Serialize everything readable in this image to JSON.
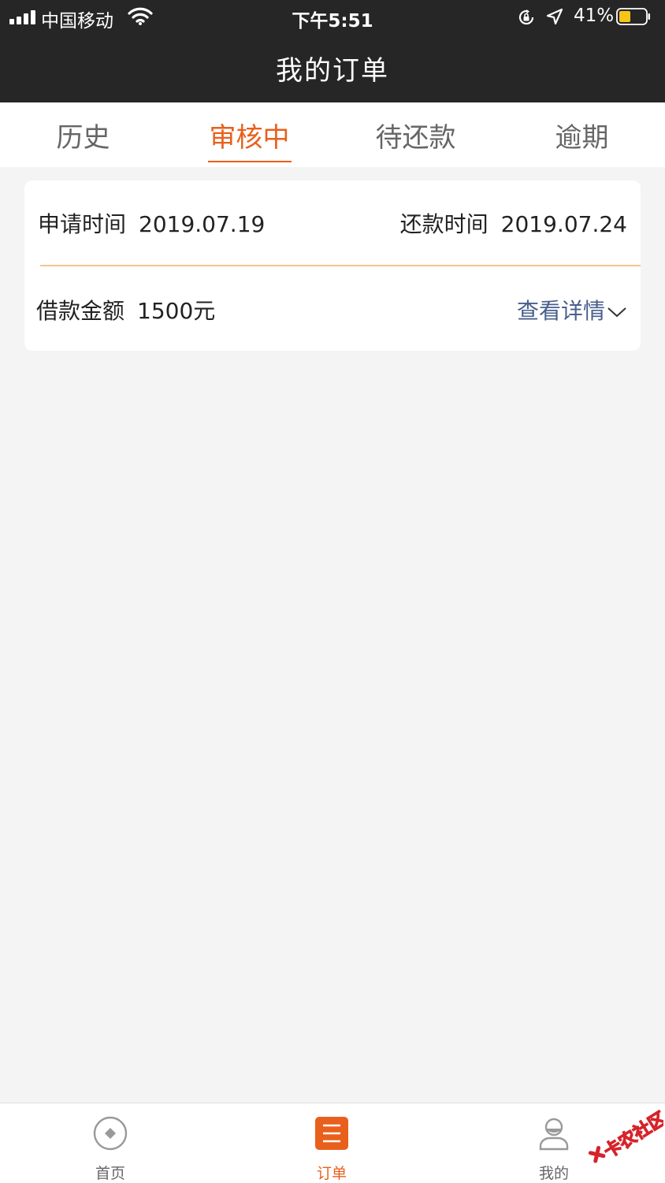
{
  "status_bar": {
    "carrier": "中国移动",
    "time": "下午5:51",
    "battery_percent": "41%",
    "battery_level": 0.41
  },
  "nav": {
    "title": "我的订单"
  },
  "tabs": [
    {
      "label": "历史",
      "active": false
    },
    {
      "label": "审核中",
      "active": true
    },
    {
      "label": "待还款",
      "active": false
    },
    {
      "label": "逾期",
      "active": false
    }
  ],
  "order": {
    "apply_time_label": "申请时间",
    "apply_time": "2019.07.19",
    "repay_time_label": "还款时间",
    "repay_time": "2019.07.24",
    "amount_label": "借款金额",
    "amount": "1500元",
    "detail_label": "查看详情"
  },
  "bottom_tabs": [
    {
      "label": "首页",
      "icon": "home-icon",
      "active": false
    },
    {
      "label": "订单",
      "icon": "order-icon",
      "active": true
    },
    {
      "label": "我的",
      "icon": "profile-icon",
      "active": false
    }
  ],
  "colors": {
    "accent": "#e8601c",
    "header_bg": "#262626",
    "link": "#4a5f8c",
    "page_bg": "#f4f4f4",
    "divider": "#f0c590"
  }
}
